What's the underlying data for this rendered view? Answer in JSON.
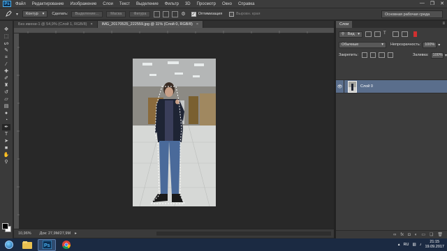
{
  "app": {
    "logo": "Ps",
    "menu": [
      "Файл",
      "Редактирование",
      "Изображение",
      "Слои",
      "Текст",
      "Выделение",
      "Фильтр",
      "3D",
      "Просмотр",
      "Окно",
      "Справка"
    ],
    "window_controls": [
      "—",
      "❐",
      "✕"
    ]
  },
  "options_bar": {
    "tool_mode": "Контур",
    "make_label": "Сделать:",
    "selection_btn": "Выделение...",
    "mask_btn": "Маска",
    "shape_btn": "Фигура",
    "autoalign_label": "Оптимизация",
    "autoalign_checked": true,
    "align_edges_label": "Выровн. края",
    "align_edges_checked": false,
    "workspace": "Основная рабочая среда"
  },
  "document_tabs": [
    {
      "label": "Без имени-1 @ 54,9% (Слой 1, RGB/8)",
      "close": "×",
      "active": false
    },
    {
      "label": "IMG_20170525_222559.jpg @ 11% (Слой 0, RGB/8)",
      "close": "×",
      "active": true
    }
  ],
  "status_bar": {
    "zoom": "10,96%",
    "doc_info": "Док: 27,9M/27,9M"
  },
  "layers_panel": {
    "tab_label": "Слои",
    "panel_menu": "≡",
    "filter_kind": "Вид",
    "blend_mode": "Обычные",
    "opacity_label": "Непрозрачность:",
    "opacity_value": "100%",
    "lock_label": "Закрепить:",
    "fill_label": "Заливка:",
    "fill_value": "100%",
    "layers": [
      {
        "name": "Слой 0",
        "visible": true,
        "selected": true
      }
    ],
    "bottom_icons": [
      "link-icon",
      "fx-icon",
      "mask-icon",
      "adjustment-icon",
      "folder-icon",
      "new-layer-icon",
      "trash-icon"
    ]
  },
  "toolbar": {
    "tools": [
      "move-tool",
      "marquee-tool",
      "lasso-tool",
      "quick-select-tool",
      "crop-tool",
      "eyedropper-tool",
      "healing-tool",
      "brush-tool",
      "clone-stamp-tool",
      "history-brush-tool",
      "eraser-tool",
      "gradient-tool",
      "blur-tool",
      "dodge-tool",
      "pen-tool",
      "type-tool",
      "path-select-tool",
      "shape-tool",
      "hand-tool",
      "zoom-tool"
    ]
  },
  "taskbar": {
    "apps": [
      "explorer-icon",
      "photoshop-icon",
      "chrome-icon"
    ],
    "language": "RU",
    "time": "21:15",
    "date": "19.09.2017"
  }
}
